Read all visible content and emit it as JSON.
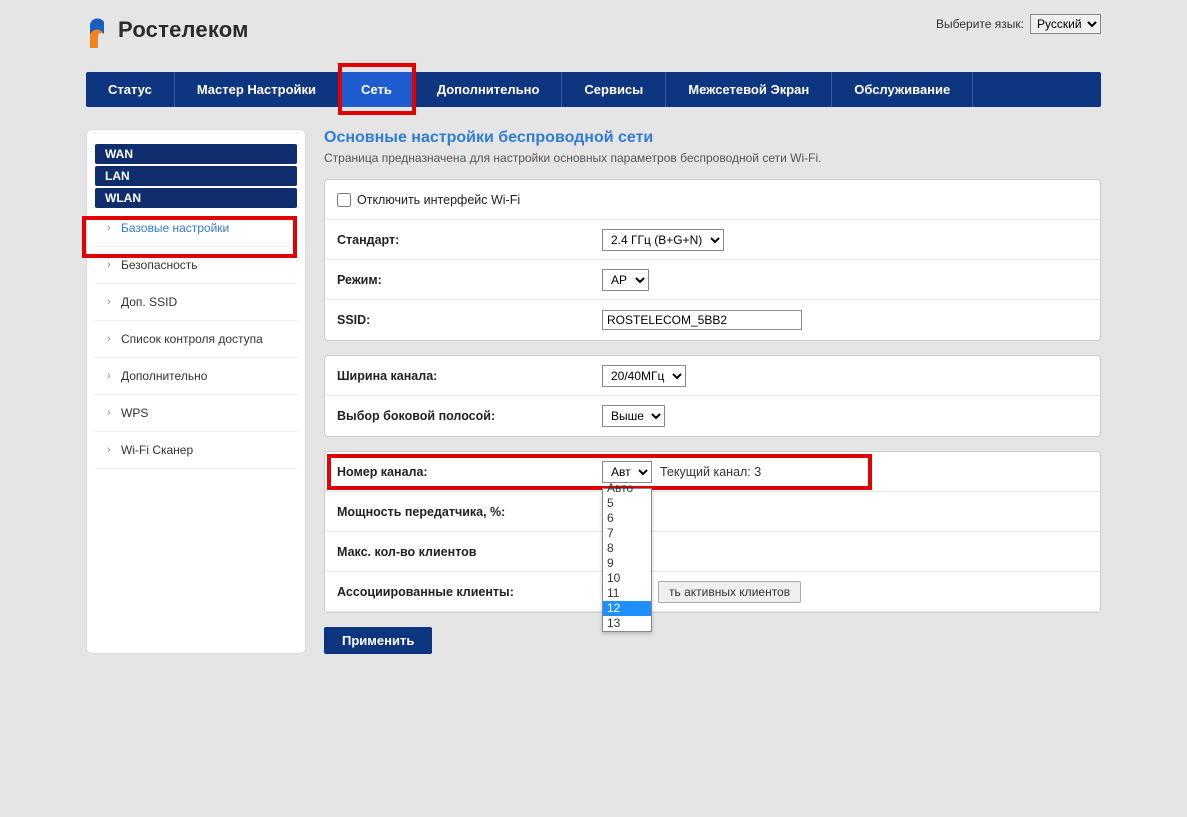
{
  "lang": {
    "label": "Выберите язык:",
    "value": "Русский"
  },
  "logo_text": "Ростелеком",
  "nav": {
    "status": "Статус",
    "wizard": "Мастер Настройки",
    "network": "Сеть",
    "advanced": "Дополнительно",
    "services": "Сервисы",
    "firewall": "Межсетевой Экран",
    "maintenance": "Обслуживание"
  },
  "sidebar": {
    "wan": "WAN",
    "lan": "LAN",
    "wlan": "WLAN",
    "items": {
      "basic": "Базовые настройки",
      "security": "Безопасность",
      "mssid": "Доп. SSID",
      "acl": "Список контроля доступа",
      "adv": "Дополнительно",
      "wps": "WPS",
      "scanner": "Wi-Fi Сканер"
    }
  },
  "page": {
    "title": "Основные настройки беспроводной сети",
    "subtitle": "Страница предназначена для настройки основных параметров беспроводной сети Wi-Fi."
  },
  "form": {
    "disable_label": "Отключить интерфейс Wi-Fi",
    "standard_label": "Стандарт:",
    "standard_value": "2.4 ГГц (B+G+N)",
    "mode_label": "Режим:",
    "mode_value": "AP",
    "ssid_label": "SSID:",
    "ssid_value": "ROSTELECOM_5BB2",
    "width_label": "Ширина канала:",
    "width_value": "20/40МГц",
    "sideband_label": "Выбор боковой полосой:",
    "sideband_value": "Выше",
    "channel_label": "Номер канала:",
    "channel_value": "Авто",
    "current_channel": "Текущий канал: 3",
    "power_label": "Мощность передатчика, %:",
    "clients_label": "Макс. кол-во клиентов",
    "assoc_label": "Ассоциированные клиенты:",
    "assoc_button": "ть активных клиентов",
    "apply": "Применить"
  },
  "dropdown_options": [
    "Авто",
    "5",
    "6",
    "7",
    "8",
    "9",
    "10",
    "11",
    "12",
    "13"
  ]
}
